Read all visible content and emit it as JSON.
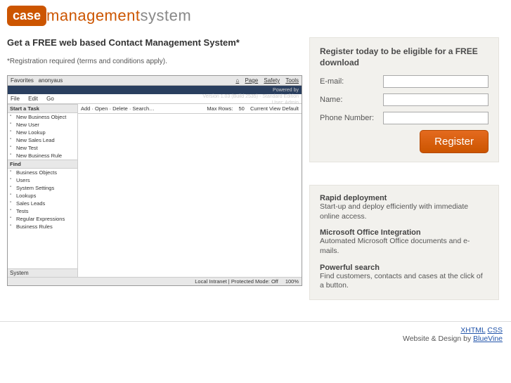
{
  "logo": {
    "mark": "case",
    "rest1": "management",
    "rest2": "system"
  },
  "headline": "Get a FREE web based Contact Management System*",
  "subnote": "*Registration required (terms and conditions apply).",
  "register_panel": {
    "title": "Register today to be eligible for a FREE download",
    "labels": {
      "email": "E-mail:",
      "name": "Name:",
      "phone": "Phone Number:"
    },
    "button": "Register"
  },
  "features": [
    {
      "title": "Rapid deployment",
      "desc": "Start-up and deploy efficiently with immediate online access."
    },
    {
      "title": "Microsoft Office Integration",
      "desc": "Automated Microsoft Office documents and e-mails."
    },
    {
      "title": "Powerful search",
      "desc": "Find customers, contacts and cases at the click of a button."
    }
  ],
  "footer": {
    "links": {
      "xhtml": "XHTML",
      "css": "CSS"
    },
    "credit_prefix": "Website & Design by ",
    "credit_link": "BlueVine"
  },
  "screenshot": {
    "browser": {
      "left_tabs": {
        "fav": "Favorites",
        "tab": "anonyaus"
      },
      "right_menu": [
        "Page",
        "Safety",
        "Tools"
      ]
    },
    "app_header": {
      "title": "",
      "powered": "Powered by",
      "version": "Version 1.03 (Build 2535) - Standard Edition",
      "user": "User: Admin"
    },
    "menu": [
      "File",
      "Edit",
      "Go"
    ],
    "toolbar": {
      "left": [
        "Add",
        "Open",
        "Delete",
        "Search…"
      ],
      "right": {
        "maxrows": "Max Rows:",
        "maxrows_val": "50",
        "view": "Current View Default"
      }
    },
    "sidebar": {
      "group1": {
        "head": "Start a Task",
        "items": [
          "New Business Object",
          "New User",
          "New Lookup",
          "New Sales Lead",
          "New Test",
          "New Business Rule"
        ]
      },
      "group2": {
        "head": "Find",
        "items": [
          "Business Objects",
          "Users",
          "System Settings",
          "Lookups",
          "Sales Leads",
          "Tests",
          "Regular Expressions",
          "Business Rules"
        ]
      },
      "system": "System"
    },
    "status": {
      "zone": "Local Intranet | Protected Mode: Off",
      "zoom": "100%"
    }
  }
}
